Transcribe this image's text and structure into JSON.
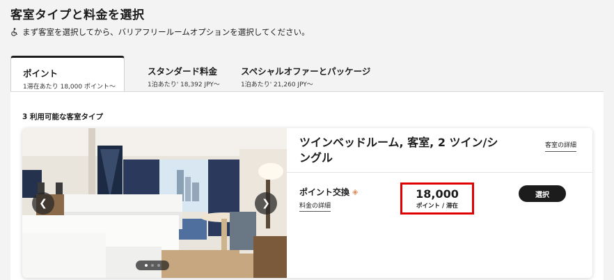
{
  "header": {
    "title": "客室タイプと料金を選択",
    "notice": "まず客室を選択してから、バリアフリールームオプションを選択してください。",
    "notice_icon": "wheelchair-icon"
  },
  "tabs": [
    {
      "label": "ポイント",
      "sub": "1滞在あたり 18,000 ポイント〜",
      "active": true
    },
    {
      "label": "スタンダード料金",
      "sub": "1泊あたり' 18,392 JPY〜",
      "active": false
    },
    {
      "label": "スペシャルオファーとパッケージ",
      "sub": "1泊あたり' 21,260 JPY〜",
      "active": false
    }
  ],
  "results": {
    "count_label": "3 利用可能な客室タイプ"
  },
  "room": {
    "name": "ツインベッドルーム, 客室, 2 ツイン/シングル",
    "details_link": "客室の詳細",
    "carousel": {
      "prev_icon": "chevron-left-icon",
      "next_icon": "chevron-right-icon",
      "slide_count": 3,
      "current_slide": 1
    },
    "rate": {
      "name": "ポイント交換",
      "tag_icon": "tag-icon",
      "details_link": "料金の詳細",
      "price": "18,000",
      "unit": "ポイント / 滞在",
      "select_label": "選択"
    }
  },
  "colors": {
    "highlight": "#e00000",
    "button": "#1c1c1c",
    "tag": "#d98f5f"
  }
}
